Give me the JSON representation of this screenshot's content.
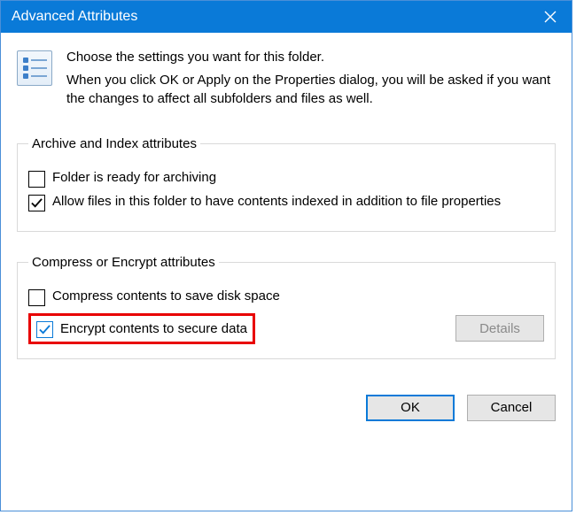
{
  "window": {
    "title": "Advanced Attributes"
  },
  "intro": {
    "line1": "Choose the settings you want for this folder.",
    "line2": "When you click OK or Apply on the Properties dialog, you will be asked if you want the changes to affect all subfolders and files as well."
  },
  "group_archive": {
    "legend": "Archive and Index attributes",
    "opt_archive": {
      "label": "Folder is ready for archiving",
      "checked": false
    },
    "opt_index": {
      "label": "Allow files in this folder to have contents indexed in addition to file properties",
      "checked": true
    }
  },
  "group_compress": {
    "legend": "Compress or Encrypt attributes",
    "opt_compress": {
      "label": "Compress contents to save disk space",
      "checked": false
    },
    "opt_encrypt": {
      "label": "Encrypt contents to secure data",
      "checked": true
    },
    "details_button": "Details",
    "details_enabled": false
  },
  "buttons": {
    "ok": "OK",
    "cancel": "Cancel"
  }
}
